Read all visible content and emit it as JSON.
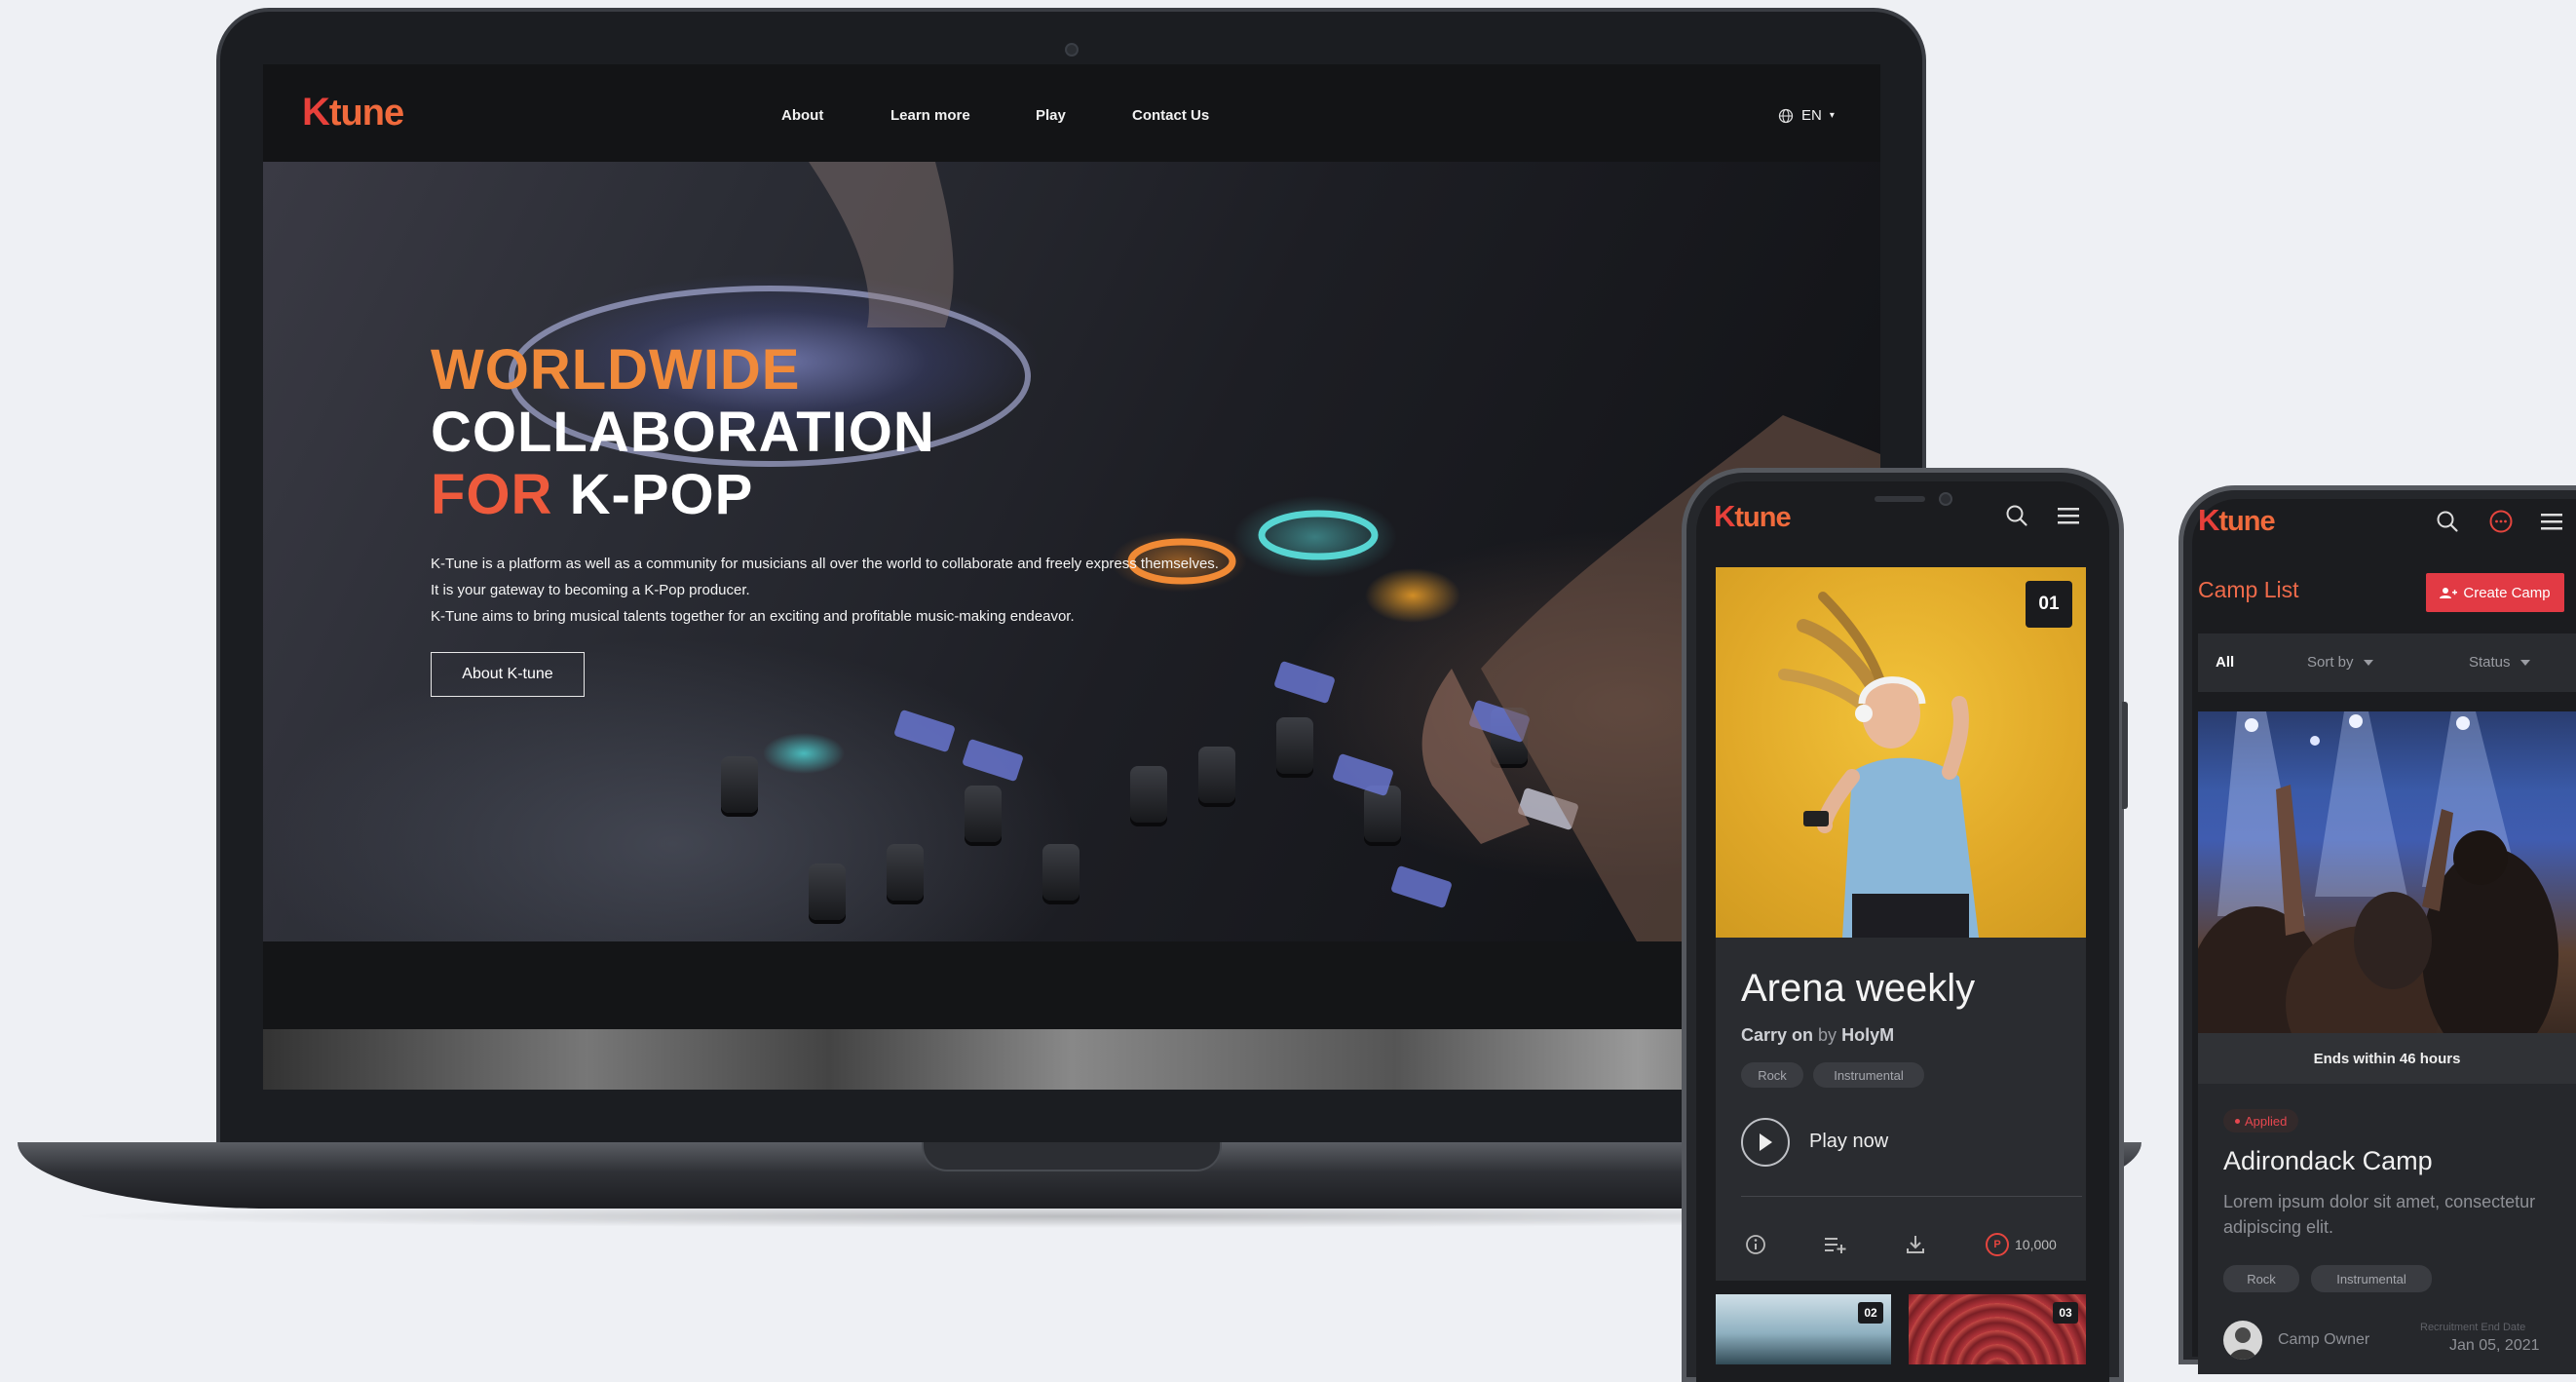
{
  "colors": {
    "brand_red": "#e8403a",
    "brand_orange": "#f06a3c",
    "accent_button": "#e23a44",
    "background": "#eef0f4"
  },
  "desktop": {
    "logo": {
      "k": "K",
      "rest": "tune"
    },
    "nav": [
      {
        "label": "About"
      },
      {
        "label": "Learn more"
      },
      {
        "label": "Play"
      },
      {
        "label": "Contact Us"
      }
    ],
    "language": {
      "icon": "globe-icon",
      "label": "EN",
      "caret": "▾"
    },
    "hero": {
      "title_line1": "WORLDWIDE",
      "title_line2": "COLLABORATION",
      "title_line3_a": "FOR",
      "title_line3_b": "K-POP",
      "desc_line1": "K-Tune is a platform as well as a community for musicians all over the world to collaborate and freely express themselves.",
      "desc_line2": "It is your gateway to becoming a K-Pop producer.",
      "desc_line3": "K-Tune aims to bring musical talents together for an exciting and profitable music-making endeavor.",
      "button": "About K-tune"
    }
  },
  "mobile_player": {
    "logo": {
      "k": "K",
      "rest": "tune"
    },
    "header_icons": [
      "search-icon",
      "menu-icon"
    ],
    "card": {
      "number": "01",
      "title": "Arena weekly",
      "song": "Carry on",
      "by": "by",
      "artist": "HolyM",
      "tags": [
        "Rock",
        "Instrumental"
      ],
      "play_label": "Play now",
      "actions": [
        "info-icon",
        "add-to-playlist-icon",
        "download-icon"
      ],
      "price_symbol": "P",
      "price": "10,000"
    },
    "thumbnails": [
      {
        "number": "02"
      },
      {
        "number": "03"
      }
    ]
  },
  "mobile_camp": {
    "logo": {
      "k": "K",
      "rest": "tune"
    },
    "header_icons": [
      "search-icon",
      "chat-icon",
      "menu-icon"
    ],
    "title": "Camp List",
    "create_button": "Create Camp",
    "filters": {
      "all": "All",
      "sort_by": "Sort by",
      "status": "Status"
    },
    "camp": {
      "ends": "Ends within 46 hours",
      "badge": "Applied",
      "title": "Adirondack Camp",
      "desc": "Lorem ipsum dolor sit amet, consectetur adipiscing elit.",
      "tags": [
        "Rock",
        "Instrumental"
      ],
      "owner": "Camp Owner",
      "end_label": "Recruitment End Date",
      "end_date": "Jan 05, 2021"
    }
  }
}
